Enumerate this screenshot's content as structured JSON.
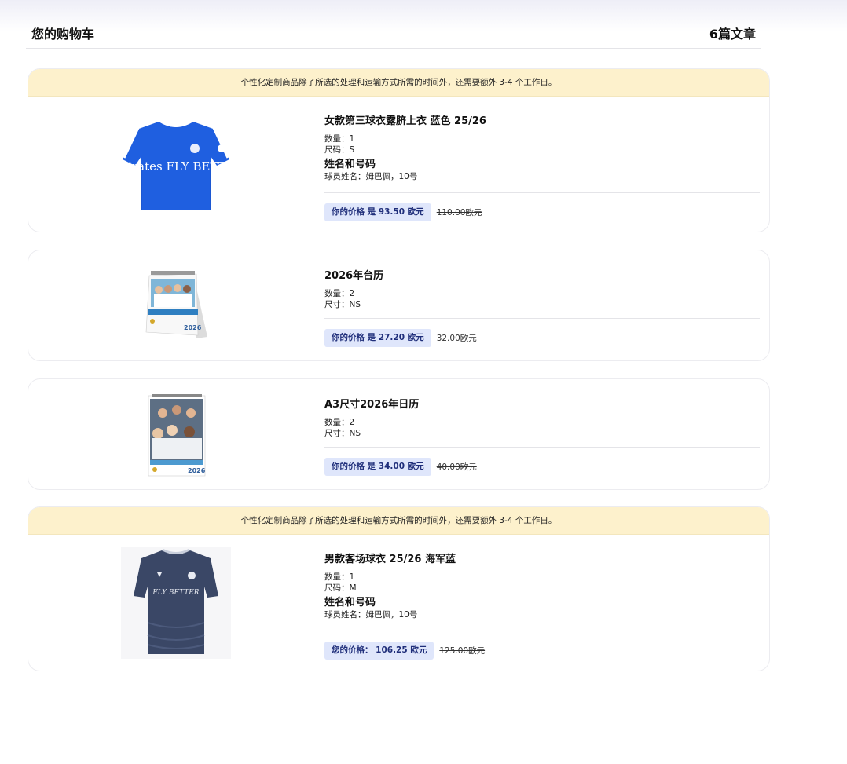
{
  "header": {
    "title": "您的购物车",
    "count": "6篇文章"
  },
  "notice_text": "个性化定制商品除了所选的处理和运输方式所需的时间外，还需要额外 3-4 个工作日。",
  "items": [
    {
      "name": "女款第三球衣露脐上衣 蓝色 25/26",
      "qty": "数量：1",
      "size": "尺码：S",
      "personalization_heading": "姓名和号码",
      "personalization": "球员姓名：姆巴佩，10号",
      "price": "你的价格 是 93.50 欧元",
      "old_price": "110.00欧元",
      "image_icon": "blue-crop-top-jersey-image",
      "image_text": "Emirates FLY BETTER"
    },
    {
      "name": "2026年台历",
      "qty": "数量：2",
      "size": "尺寸：NS",
      "price": "你的价格 是 27.20 欧元",
      "old_price": "32.00欧元",
      "image_icon": "desk-calendar-image",
      "image_text": "2026"
    },
    {
      "name": "A3尺寸2026年日历",
      "qty": "数量：2",
      "size": "尺寸：NS",
      "price": "你的价格 是 34.00 欧元",
      "old_price": "40.00欧元",
      "image_icon": "wall-calendar-image",
      "image_text": "2026"
    },
    {
      "name": "男款客场球衣 25/26 海军蓝",
      "qty": "数量：1",
      "size": "尺码：M",
      "personalization_heading": "姓名和号码",
      "personalization": "球员姓名：姆巴佩，10号",
      "price": "您的价格： 106.25 欧元",
      "old_price": "125.00欧元",
      "image_icon": "navy-away-jersey-image",
      "image_text": "FLY BETTER"
    }
  ],
  "colors": {
    "notice_bg": "#fdf1cc",
    "price_badge_bg": "#dfe6fb",
    "price_badge_text": "#1f2e7a",
    "jersey_blue": "#1f5fe0",
    "jersey_navy": "#3a4766"
  }
}
